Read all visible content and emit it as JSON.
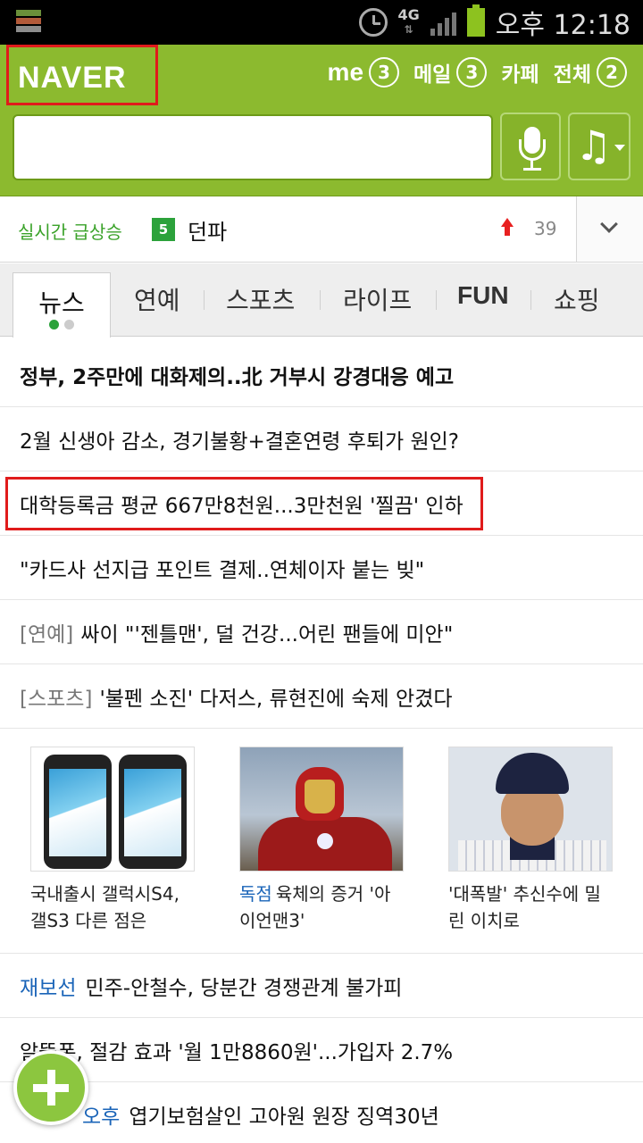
{
  "status_bar": {
    "time": "오후 12:18",
    "network": "4G"
  },
  "header": {
    "logo": "NAVER",
    "nav": [
      {
        "label": "me",
        "count": "3"
      },
      {
        "label": "메일",
        "count": "3"
      },
      {
        "label": "카페"
      },
      {
        "label": "전체",
        "count": "2"
      }
    ],
    "search_value": ""
  },
  "trending": {
    "label": "실시간 급상승",
    "rank": "5",
    "keyword": "던파",
    "count": "39"
  },
  "tabs": [
    "뉴스",
    "연예",
    "스포츠",
    "라이프",
    "FUN",
    "쇼핑"
  ],
  "news": [
    {
      "text": "정부, 2주만에 대화제의..北 거부시 강경대응 예고"
    },
    {
      "text": "2월 신생아 감소, 경기불황+결혼연령 후퇴가 원인?"
    },
    {
      "text": "대학등록금 평균 667만8천원...3만천원 '찔끔' 인하"
    },
    {
      "text": "\"카드사 선지급 포인트 결제..연체이자 붙는 빚\""
    },
    {
      "category": "[연예]",
      "text": "싸이 \"'젠틀맨', 덜 건강...어린 팬들에 미안\""
    },
    {
      "category": "[스포츠]",
      "text": "'불펜 소진' 다저스, 류현진에 숙제 안겼다"
    }
  ],
  "cards": [
    {
      "line1": "국내출시 갤럭시S4,",
      "line2": "갤S3 다른 점은"
    },
    {
      "tag": "독점",
      "line1": "육체의 증거 '아",
      "line2": "이언맨3'"
    },
    {
      "line1": "'대폭발' 추신수에 밀",
      "line2": "린 이치로"
    }
  ],
  "more_news": [
    {
      "tag": "재보선",
      "text": "민주-안철수, 당분간 경쟁관계 불가피"
    },
    {
      "text": "알뜰폰, 절감 효과 '월 1만8860원'...가입자 2.7%"
    },
    {
      "tag": "오후",
      "text": "엽기보험살인 고아원 원장 징역30년"
    }
  ]
}
